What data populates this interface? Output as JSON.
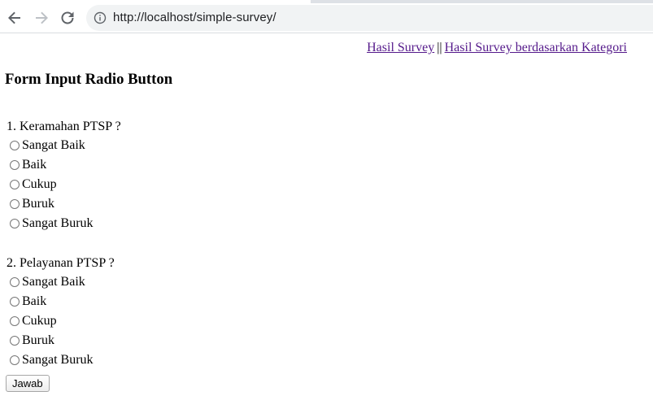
{
  "browser": {
    "url": "http://localhost/simple-survey/"
  },
  "nav": {
    "link1": "Hasil Survey",
    "separator": "||",
    "link2": "Hasil Survey berdasarkan Kategori"
  },
  "form": {
    "title": "Form Input Radio Button",
    "questions": [
      {
        "label": "1. Keramahan PTSP ?",
        "options": [
          "Sangat Baik",
          "Baik",
          "Cukup",
          "Buruk",
          "Sangat Buruk"
        ]
      },
      {
        "label": "2. Pelayanan PTSP ?",
        "options": [
          "Sangat Baik",
          "Baik",
          "Cukup",
          "Buruk",
          "Sangat Buruk"
        ]
      }
    ],
    "submit_label": "Jawab"
  }
}
